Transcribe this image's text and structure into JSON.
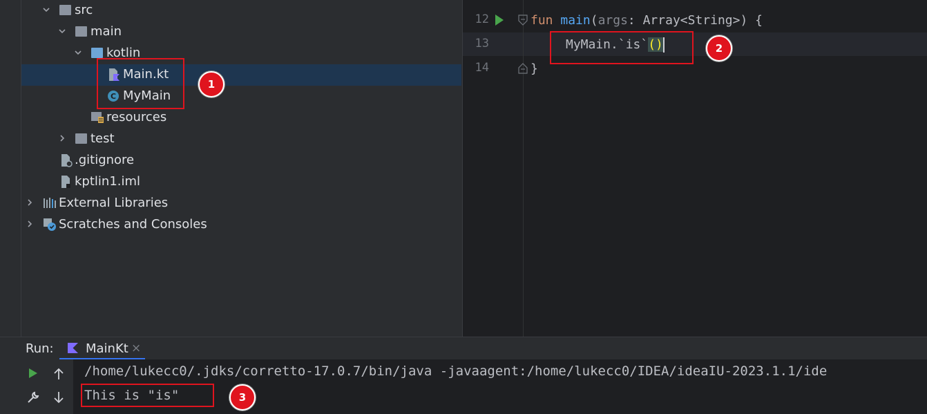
{
  "tree": {
    "items": [
      {
        "label": "src"
      },
      {
        "label": "main"
      },
      {
        "label": "kotlin"
      },
      {
        "label": "Main.kt"
      },
      {
        "label": "MyMain"
      },
      {
        "label": "resources"
      },
      {
        "label": "test"
      },
      {
        "label": ".gitignore"
      },
      {
        "label": "kptlin1.iml"
      },
      {
        "label": "External Libraries"
      },
      {
        "label": "Scratches and Consoles"
      }
    ]
  },
  "editor": {
    "line_numbers": [
      "12",
      "13",
      "14"
    ],
    "line12": {
      "kw": "fun",
      "fn": "main",
      "open": "(",
      "param": "args",
      "rest": ": Array<String>) {"
    },
    "line13": {
      "code": "MyMain.`is`",
      "parens": "()"
    },
    "line14": {
      "code": "}"
    }
  },
  "run": {
    "label": "Run:",
    "tab": "MainKt",
    "close": "×"
  },
  "console": {
    "lines": [
      "/home/lukecc0/.jdks/corretto-17.0.7/bin/java -javaagent:/home/lukecc0/IDEA/ideaIU-2023.1.1/ide",
      "This is \"is\""
    ]
  },
  "badges": [
    "1",
    "2",
    "3"
  ],
  "colors": {
    "annotation_red": "#e0141e",
    "selection": "#1e3650"
  }
}
